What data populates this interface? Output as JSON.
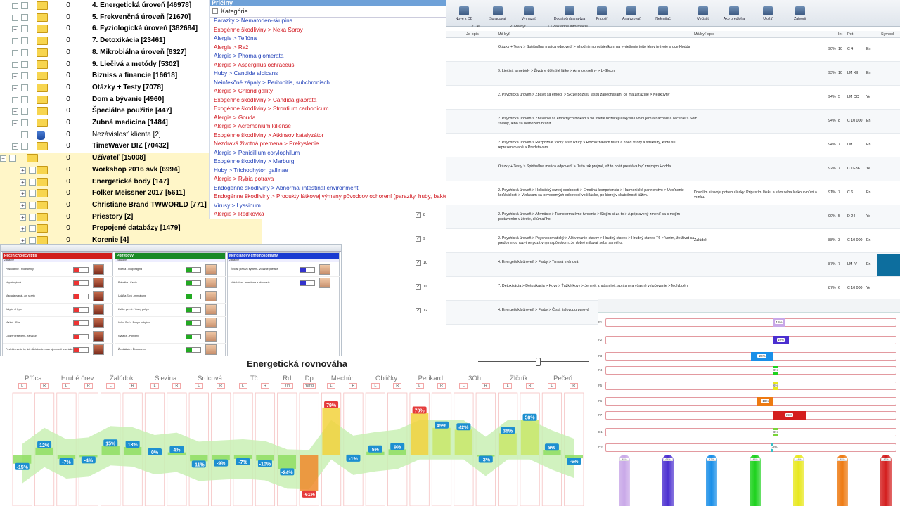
{
  "tree": {
    "rows": [
      {
        "count": "0",
        "label": "4. Energetická úroveň [46978]"
      },
      {
        "count": "0",
        "label": "5. Frekvenčná úroveň [21670]"
      },
      {
        "count": "0",
        "label": "6. Fyziologická úroveň [382684]"
      },
      {
        "count": "0",
        "label": "7. Detoxikácia [23461]"
      },
      {
        "count": "0",
        "label": "8. Mikrobiálna úroveň [8327]"
      },
      {
        "count": "0",
        "label": "9. Liečivá a metódy [5302]"
      },
      {
        "count": "0",
        "label": "Bizniss a financie [16618]"
      },
      {
        "count": "0",
        "label": "Otázky + Testy [7078]"
      },
      {
        "count": "0",
        "label": "Dom a bývanie [4960]"
      },
      {
        "count": "0",
        "label": "Špeciálne použitie [447]"
      },
      {
        "count": "0",
        "label": "Zubná medicína [1484]"
      },
      {
        "count": "0",
        "label": "Nezávislosť klienta [2]"
      },
      {
        "count": "0",
        "label": "TimeWaver BIZ [70432]"
      },
      {
        "count": "0",
        "label": "Užívateľ [15008]"
      },
      {
        "count": "0",
        "label": "Workshop 2016 svk [6994]"
      },
      {
        "count": "0",
        "label": "Energetické body [147]"
      },
      {
        "count": "0",
        "label": "Folker Meissner 2017 [5611]"
      },
      {
        "count": "0",
        "label": "Christiane Brand TWWORLD [771]"
      },
      {
        "count": "0",
        "label": "Priestory [2]"
      },
      {
        "count": "0",
        "label": "Prepojené databázy [1479]"
      },
      {
        "count": "0",
        "label": "Korenie [4]"
      }
    ]
  },
  "causes": {
    "title": "Príčiny",
    "category_label": "Kategórie",
    "items": [
      {
        "text": "Parazity > Nematoden-skupina",
        "color": "blue"
      },
      {
        "text": "Exogénne škodliviny > Nexa Spray",
        "color": "red"
      },
      {
        "text": "Alergie > Teflóna",
        "color": "blue"
      },
      {
        "text": "Alergie > Raž",
        "color": "red"
      },
      {
        "text": "Alergie > Phoma glomerata",
        "color": "blue"
      },
      {
        "text": "Alergie > Aspergillus ochraceus",
        "color": "red"
      },
      {
        "text": "Huby > Candida albicans",
        "color": "blue"
      },
      {
        "text": "Neinfekčné zápaly > Peritonitis, subchronisch",
        "color": "blue"
      },
      {
        "text": "Alergie > Chlorid gallitý",
        "color": "red"
      },
      {
        "text": "Exogénne škodliviny > Candida glabrata",
        "color": "red"
      },
      {
        "text": "Exogénne škodliviny > Strontium carbonicum",
        "color": "red"
      },
      {
        "text": "Alergie > Gouda",
        "color": "red"
      },
      {
        "text": "Alergie > Acremonium kiliense",
        "color": "red"
      },
      {
        "text": "Exogénne škodliviny > Atkinsov katalyzátor",
        "color": "red"
      },
      {
        "text": "Nezdravá životná premena > Prekyslenie",
        "color": "red"
      },
      {
        "text": "Alergie > Penicillium corylophilum",
        "color": "blue"
      },
      {
        "text": "Exogénne škodliviny > Marburg",
        "color": "blue"
      },
      {
        "text": "Huby > Trichophyton gallinae",
        "color": "blue"
      },
      {
        "text": "Alergie > Rybia potrava",
        "color": "red"
      },
      {
        "text": "Endogénne škodliviny > Abnormal intestinal environment",
        "color": "blue"
      },
      {
        "text": "Endogénne škodliviny > Produkty látkovej výmeny pôvodcov ochorení (parazity, huby, baktérie",
        "color": "red"
      },
      {
        "text": "Vírusy > Lyssinum",
        "color": "blue"
      },
      {
        "text": "Alergie > Reďkovka",
        "color": "red"
      }
    ]
  },
  "toolbar": {
    "buttons": [
      "Nové z DB",
      "Spracovať",
      "Vymazať",
      "Dodatočná analýza",
      "Pripojiť",
      "Analyzovať",
      "Nekmitač",
      "Vyčistiť",
      "Ako predloha",
      "Uložiť",
      "Zatvoriť"
    ]
  },
  "table": {
    "filter_je": "Je",
    "filter_mabyt": "Má byť",
    "filter_info": "Základné informácie",
    "col_je_opis": "Je-opis",
    "col_ma_byt": "Má byť",
    "col_ma_byt_opis": "Má byť-opis",
    "col_int": "Int",
    "col_pot": "Pot",
    "col_symbol": "Symbol",
    "rows": [
      {
        "num": "",
        "text": "Otázky + Testy > Spirituálna matica odpovedí > Vhodným prostriedkom na vyriešenie tejto témy je tvoje srdce Hodda",
        "opis": "",
        "pct": "90%",
        "int": "10",
        "pot": "C 4",
        "sym": "En"
      },
      {
        "num": "",
        "text": "9. Liečivá a metódy > Životne dôležité látky > Aminokyseliny > L-Glycin",
        "opis": "",
        "pct": "93%",
        "int": "10",
        "pot": "LM XII",
        "sym": "En"
      },
      {
        "num": "",
        "text": "2. Psychická úroveň > Zbaviť sa emócií > Skrze božskú lásku zanechávam, čo ma zaťažuje > Neaktívny",
        "opis": "",
        "pct": "94%",
        "int": "5",
        "pot": "LM CC",
        "sym": "Ye"
      },
      {
        "num": "",
        "text": "2. Psychická úroveň > Zbavenie sa emočných blokád > Vo svetle božskej lásky sa uvoľnujem a nachádza liečenie > Som zoľaný, lebo sa nemôžem brániť",
        "opis": "",
        "pct": "94%",
        "int": "8",
        "pot": "C 10 000",
        "sym": "En"
      },
      {
        "num": "",
        "text": "2. Psychická úroveň > Rozpoznať vzory a štruktúry > Rozpoznávam teraz a hneď vzory a štruktúry, ktoré sú reprezentované > Predstavami",
        "opis": "",
        "pct": "94%",
        "int": "7",
        "pot": "LM I",
        "sym": "En"
      },
      {
        "num": "",
        "text": "Otázky + Testy > Spirituálna matica odpovedí > Je to tak prejmé, až to opäť prestáva byť zrejmým Hodda",
        "opis": "",
        "pct": "92%",
        "int": "7",
        "pot": "C 1E36",
        "sym": "Ye"
      },
      {
        "num": "",
        "text": "2. Psychická úroveň > Holistický rozvoj osobnosti > Emočná kompetencia > Harmonické partnerstvo > Uvoľnenie koďávislosti > Vzdávam sa nevedomých odpovedí voči láske, po ktorej v skutočnosti túžim.",
        "opis": "Dovolím si svoju potrebu lásky. Pripustím lásku a sám seba láskou vnútri a vonku.",
        "pct": "91%",
        "int": "7",
        "pot": "C 6",
        "sym": "En"
      },
      {
        "num": "8",
        "text": "2. Psychická úroveň > Afirmácie > Transformatívne tvrdenia > Stojím si za to > A pripravený zmeniť sa s mojím postavením v živote, skúmať ho.",
        "opis": "",
        "pct": "90%",
        "int": "5",
        "pot": "D 24",
        "sym": "Ye"
      },
      {
        "num": "9",
        "text": "2. Psychická úroveň > Psychosomatický > Aktivovanie stavov > Hrudný stavec > Hrudný stavec T6 > Verím, že život sa predo mnou rozvinie pozitívnym spôsobom. Je dobré milovať seba samého.",
        "opis": "Žalúdok",
        "pct": "88%",
        "int": "3",
        "pot": "C 10 000",
        "sym": "En"
      },
      {
        "num": "10",
        "text": "4. Energetická úroveň > Farby > Tmavá kvánová",
        "opis": "",
        "pct": "87%",
        "int": "7",
        "pot": "LM IV",
        "sym": "En"
      },
      {
        "num": "11",
        "text": "7. Detoxikácia > Detoxikácia > Kovy > Ťažké kovy > Jemné, znášanlivé, správne a včasné vylučovanie > Molybdén",
        "opis": "",
        "pct": "87%",
        "int": "6",
        "pot": "C 10 000",
        "sym": "Ye"
      },
      {
        "num": "12",
        "text": "4. Energetická úroveň > Farby > Čistá fialovopurpurová",
        "opis": "",
        "pct": "",
        "int": "",
        "pot": "",
        "sym": ""
      }
    ]
  },
  "organ_panel": {
    "columns": [
      {
        "title": "Pečeň/cholecystitis",
        "subtitle": "Základné",
        "color": "#d11d1d",
        "rows": [
          "Poškodenie - Podmienky",
          "Hepatocytová",
          "Viacfalizovaná - ani skrytú",
          "Kalyón - Hypo",
          "Vlažnú - Ráz",
          "Crozny prelepleri - Yanapun",
          "Pevlekim za tie ky tieľ - Ávlubanie mase ujemnosti tesurásla"
        ]
      },
      {
        "title": "Pohybový",
        "subtitle": "Základné",
        "color": "#1a8a27",
        "rows": [
          "Kolena - Diaphragma",
          "Potvržka - Cekta",
          "Udaľka Srvú - mmrávane",
          "Ľahke pevné - Vraný pohyb",
          "Vrčva Srvú - Pohyb pohylovu",
          "Nynaďa - Pohybry",
          "Živolaklaťe - Ďivsdorvon"
        ]
      },
      {
        "title": "Meridiánový chromosomálny",
        "subtitle": "Základné",
        "color": "#1a3bd1",
        "rows": [
          "Živolisť poviazk systém - Vodárne prietake",
          "Hakálačka - mhrnôvna a přávnasia"
        ]
      }
    ]
  },
  "energy": {
    "title": "Energetická rovnováha",
    "organs": [
      "Pľúca",
      "Hrubé črev",
      "Žalúdok",
      "Slezina",
      "Srdcová",
      "Tč",
      "Rd",
      "Dp",
      "Mechúr",
      "Obličky",
      "Perikard",
      "3Oh",
      "Žlčník",
      "Pečeň"
    ],
    "extra_labels": [
      "Yin",
      "Yang"
    ],
    "chart_data": {
      "type": "bar",
      "categories": [
        "Pľúca L",
        "Pľúca R",
        "Hrubé črev L",
        "Hrubé črev R",
        "Žalúdok L",
        "Žalúdok R",
        "Slezina L",
        "Slezina R",
        "Srdcová L",
        "Srdcová R",
        "Tč L",
        "Tč R",
        "Rd Yin",
        "Dp Yang",
        "Mechúr L",
        "Mechúr R",
        "Obličky L",
        "Obličky R",
        "Perikard L",
        "Perikard R",
        "3Oh L",
        "3Oh R",
        "Žlčník L",
        "Žlčník R",
        "Pečeň L",
        "Pečeň R"
      ],
      "values": [
        -15,
        12,
        -7,
        -4,
        15,
        13,
        0,
        4,
        -11,
        -9,
        -7,
        -10,
        -24,
        -61,
        79,
        -1,
        5,
        9,
        70,
        45,
        42,
        -3,
        36,
        58,
        8,
        -6
      ],
      "labels": [
        "-15%",
        "12%",
        "-7%",
        "-4%",
        "15%",
        "13%",
        "0%",
        "4%",
        "-11%",
        "-9%",
        "-7%",
        "-10%",
        "-24%",
        "-61%",
        "79%",
        "-1%",
        "5%",
        "9%",
        "70%",
        "45%",
        "42%",
        "-3%",
        "36%",
        "58%",
        "8%",
        "-6%"
      ],
      "ylim": [
        -100,
        100
      ]
    }
  },
  "br_chart": {
    "rows": [
      {
        "label": "F1",
        "value": 15,
        "text": "15%",
        "color": "#c9a8e8"
      },
      {
        "label": "F2",
        "value": 19,
        "text": "19%",
        "color": "#4b2fd0"
      },
      {
        "label": "F3",
        "value": -26,
        "text": "-26%",
        "color": "#1a8fe8"
      },
      {
        "label": "F4",
        "value": 6,
        "text": "6%",
        "color": "#1ed21e"
      },
      {
        "label": "F5",
        "value": 6,
        "text": "6%",
        "color": "#e8e81e"
      },
      {
        "label": "F6",
        "value": -18,
        "text": "-18%",
        "color": "#ee7a12"
      },
      {
        "label": "F7",
        "value": 39,
        "text": "39%",
        "color": "#d41e1e"
      },
      {
        "label": "D1",
        "value": 6,
        "text": "6%",
        "color": "#7ad53a"
      },
      {
        "label": "D2",
        "value": -2,
        "text": "-2%",
        "color": "#36c0c8"
      }
    ],
    "col_tags": [
      "48%",
      "64%",
      "47%",
      "45%",
      "44%",
      "48%",
      "47%"
    ],
    "col_colors": [
      "#c9a8e8",
      "#4b2fd0",
      "#1a8fe8",
      "#1ed21e",
      "#e8e81e",
      "#ee7a12",
      "#d41e1e"
    ]
  }
}
